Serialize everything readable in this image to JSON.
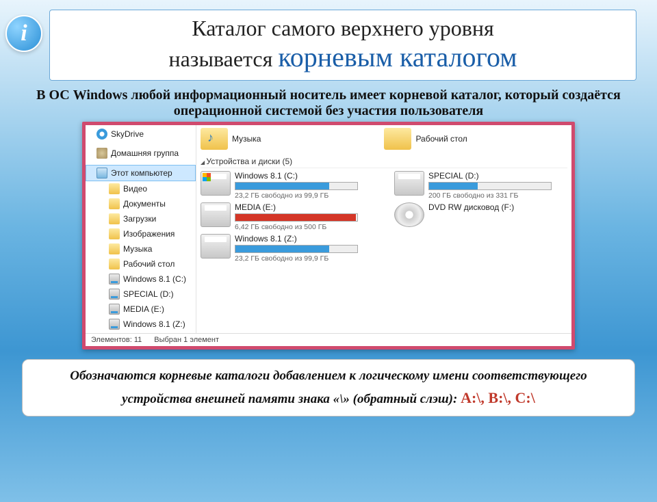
{
  "title": {
    "line1": "Каталог самого верхнего уровня",
    "line2_prefix": "называется ",
    "line2_em": "корневым каталогом"
  },
  "subtitle": "В ОС Windows любой информационный носитель имеет корневой каталог, который создаётся операционной системой без участия пользователя",
  "sidebar": {
    "sky": "SkyDrive",
    "homegroup": "Домашняя группа",
    "thispc": "Этот компьютер",
    "items": [
      "Видео",
      "Документы",
      "Загрузки",
      "Изображения",
      "Музыка",
      "Рабочий стол",
      "Windows 8.1 (C:)",
      "SPECIAL (D:)",
      "MEDIA (E:)",
      "Windows 8.1 (Z:)"
    ]
  },
  "folders": {
    "music": "Музыка",
    "desktop": "Рабочий стол"
  },
  "section_header": "Устройства и диски (5)",
  "drives": [
    {
      "name": "Windows 8.1 (C:)",
      "stat": "23,2 ГБ свободно из 99,9 ГБ",
      "fill": 77,
      "color": "blue",
      "type": "win"
    },
    {
      "name": "SPECIAL (D:)",
      "stat": "200 ГБ свободно из 331 ГБ",
      "fill": 40,
      "color": "blue",
      "type": "hdd"
    },
    {
      "name": "MEDIA (E:)",
      "stat": "6,42 ГБ свободно из 500 ГБ",
      "fill": 99,
      "color": "red",
      "type": "hdd"
    },
    {
      "name": "DVD RW дисковод (F:)",
      "stat": "",
      "fill": 0,
      "color": "none",
      "type": "dvd"
    },
    {
      "name": "Windows 8.1 (Z:)",
      "stat": "23,2 ГБ свободно из 99,9 ГБ",
      "fill": 77,
      "color": "blue",
      "type": "hdd"
    }
  ],
  "statusbar": {
    "count": "Элементов: 11",
    "selected": "Выбран 1 элемент"
  },
  "footer": {
    "text": "Обозначаются корневые каталоги добавлением к логическому имени соответствующего устройства внешней памяти знака «\\» (обратный слэш): ",
    "em": "А:\\, В:\\, С:\\"
  }
}
